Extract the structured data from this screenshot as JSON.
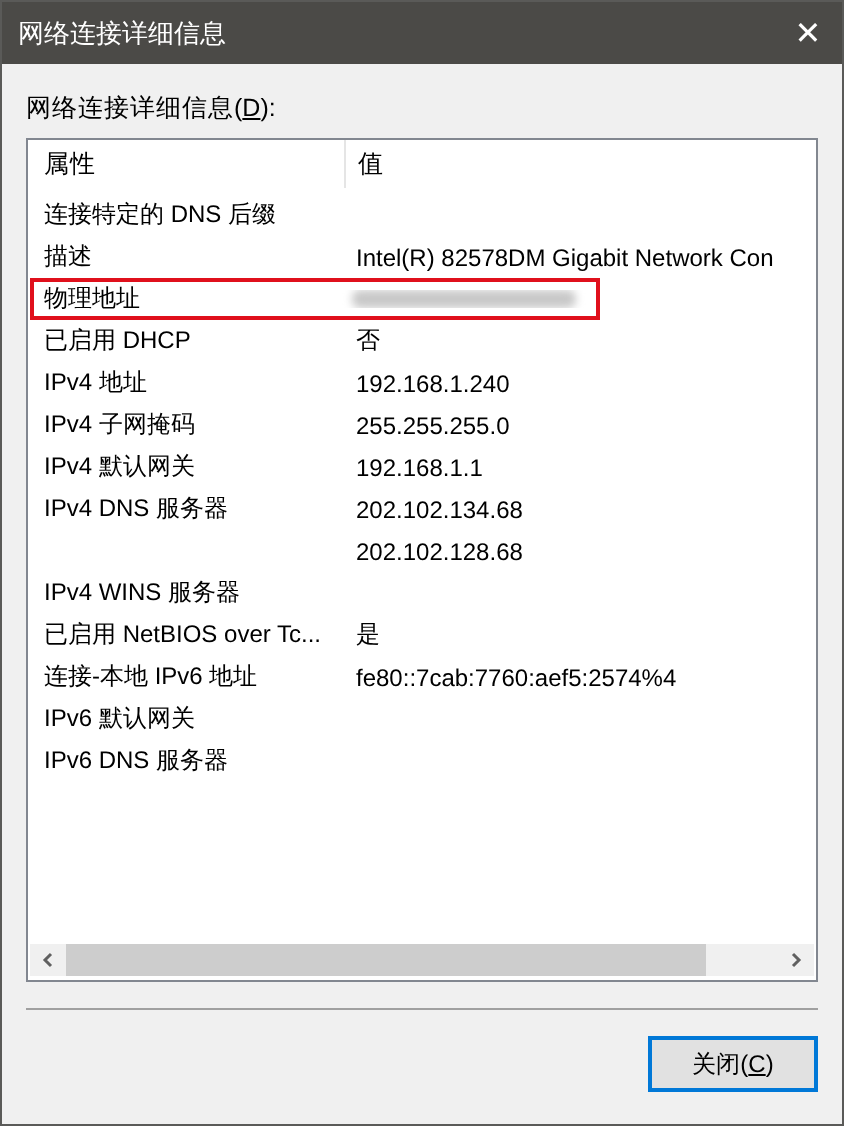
{
  "window": {
    "title": "网络连接详细信息",
    "close_glyph": "✕"
  },
  "label": "网络连接详细信息(D):",
  "table": {
    "columns": [
      "属性",
      "值"
    ],
    "rows": [
      {
        "property": "连接特定的 DNS 后缀",
        "highlighted": false
      },
      {
        "property": "描述",
        "value": "Intel(R) 82578DM Gigabit Network Con",
        "highlighted": false
      },
      {
        "property": "物理地址",
        "value_obscured": true,
        "highlighted": true
      },
      {
        "property": "已启用 DHCP",
        "value": "否",
        "highlighted": false
      },
      {
        "property": "IPv4 地址",
        "value": "192.168.1.240",
        "highlighted": false
      },
      {
        "property": "IPv4 子网掩码",
        "value": "255.255.255.0",
        "highlighted": false
      },
      {
        "property": "IPv4 默认网关",
        "value": "192.168.1.1",
        "highlighted": false
      },
      {
        "property": "IPv4 DNS 服务器",
        "value": "202.102.134.68",
        "highlighted": false
      },
      {
        "value": "202.102.128.68",
        "highlighted": false
      },
      {
        "property": "IPv4 WINS 服务器",
        "highlighted": false
      },
      {
        "property": "已启用 NetBIOS over Tc...",
        "value": "是",
        "highlighted": false
      },
      {
        "property": "连接-本地 IPv6 地址",
        "value": "fe80::7cab:7760:aef5:2574%4",
        "highlighted": false
      },
      {
        "property": "IPv6 默认网关",
        "highlighted": false
      },
      {
        "property": "IPv6 DNS 服务器",
        "highlighted": false
      }
    ]
  },
  "buttons": [
    {
      "label": "关闭(C)",
      "focused": true
    }
  ]
}
